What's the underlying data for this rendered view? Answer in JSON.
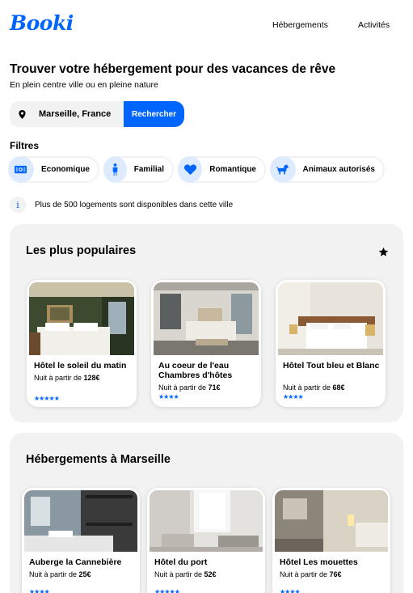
{
  "brand": {
    "logo": "Booki",
    "accent": "#0065FC"
  },
  "nav": [
    {
      "label": "Hébergements"
    },
    {
      "label": "Activités"
    }
  ],
  "hero": {
    "title": "Trouver votre hébergement pour des vacances de rêve",
    "subtitle": "En plein centre ville ou en pleine nature"
  },
  "search": {
    "icon": "location-pin-icon",
    "value": "Marseille, France",
    "button_label": "Rechercher"
  },
  "filters": {
    "label": "Filtres",
    "items": [
      {
        "label": "Economique",
        "icon": "money-icon"
      },
      {
        "label": "Familial",
        "icon": "person-icon"
      },
      {
        "label": "Romantique",
        "icon": "heart-icon"
      },
      {
        "label": "Animaux autorisés",
        "icon": "dog-icon"
      }
    ]
  },
  "info": {
    "icon": "info-icon",
    "text": "Plus de 500 logements sont disponibles dans cette ville"
  },
  "popular": {
    "title": "Les plus populaires",
    "icon": "star-icon",
    "cards": [
      {
        "name": "Hôtel le soleil du matin",
        "price_prefix": "Nuit à partir de ",
        "price": "128€",
        "rating": 5
      },
      {
        "name": "Au coeur de l'eau Chambres d'hôtes",
        "price_prefix": "Nuit à partir de ",
        "price": "71€",
        "rating": 4
      },
      {
        "name": "Hôtel Tout bleu et Blanc",
        "price_prefix": "Nuit à partir de ",
        "price": "68€",
        "rating": 4
      }
    ]
  },
  "marseille": {
    "title": "Hébergements à Marseille",
    "cards": [
      {
        "name": "Auberge la Cannebière",
        "price_prefix": "Nuit à partir de ",
        "price": "25€",
        "rating": 4
      },
      {
        "name": "Hôtel du port",
        "price_prefix": "Nuit à partir de ",
        "price": "52€",
        "rating": 5
      },
      {
        "name": "Hôtel Les mouettes",
        "price_prefix": "Nuit à partir de ",
        "price": "76€",
        "rating": 4
      }
    ]
  }
}
